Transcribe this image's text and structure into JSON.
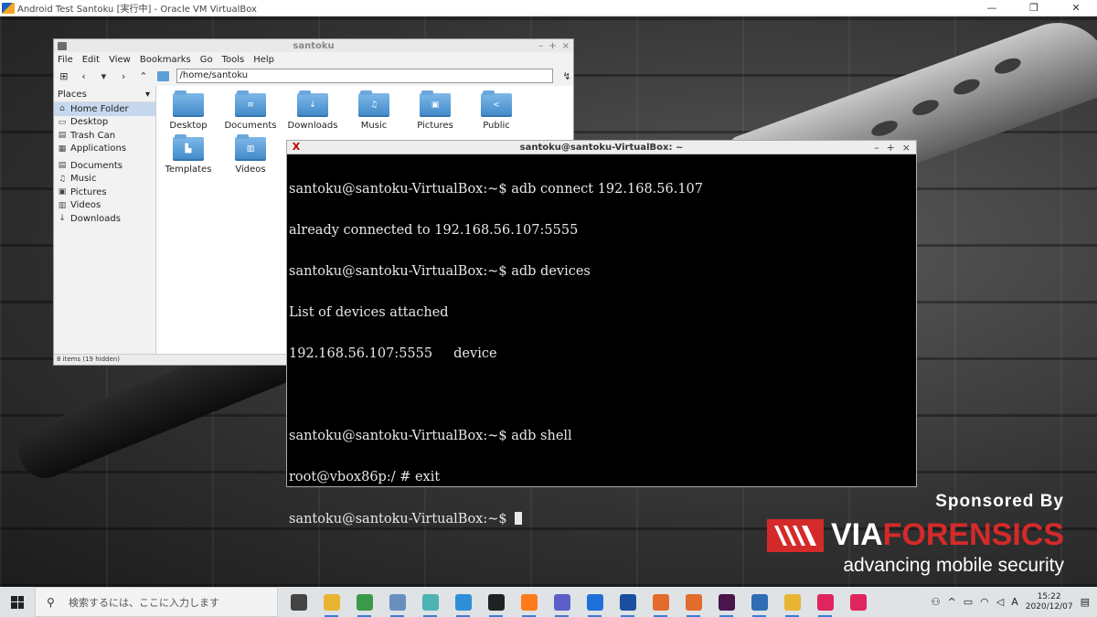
{
  "vbox": {
    "title": "Android Test Santoku [実行中] - Oracle VM VirtualBox",
    "minimize": "—",
    "maximize": "❐",
    "close": "✕"
  },
  "file_manager": {
    "title": "santoku",
    "window_controls": [
      "–",
      "+",
      "×"
    ],
    "menu": [
      "File",
      "Edit",
      "View",
      "Bookmarks",
      "Go",
      "Tools",
      "Help"
    ],
    "path": "/home/santoku",
    "places_header": "Places",
    "places_group1": [
      {
        "label": "Home Folder",
        "icon": "home-icon",
        "active": true
      },
      {
        "label": "Desktop",
        "icon": "desktop-icon",
        "active": false
      },
      {
        "label": "Trash Can",
        "icon": "trash-icon",
        "active": false
      },
      {
        "label": "Applications",
        "icon": "applications-icon",
        "active": false
      }
    ],
    "places_group2": [
      {
        "label": "Documents",
        "icon": "documents-icon"
      },
      {
        "label": "Music",
        "icon": "music-icon"
      },
      {
        "label": "Pictures",
        "icon": "pictures-icon"
      },
      {
        "label": "Videos",
        "icon": "videos-icon"
      },
      {
        "label": "Downloads",
        "icon": "downloads-icon"
      }
    ],
    "folders": [
      {
        "label": "Desktop",
        "glyph": ""
      },
      {
        "label": "Documents",
        "glyph": "≡"
      },
      {
        "label": "Downloads",
        "glyph": "↓"
      },
      {
        "label": "Music",
        "glyph": "♫"
      },
      {
        "label": "Pictures",
        "glyph": "▣"
      },
      {
        "label": "Public",
        "glyph": "<"
      },
      {
        "label": "Templates",
        "glyph": "▙"
      },
      {
        "label": "Videos",
        "glyph": "▥"
      }
    ],
    "status": "8 items (19 hidden)"
  },
  "terminal": {
    "title": "santoku@santoku-VirtualBox: ~",
    "window_controls": [
      "–",
      "+",
      "×"
    ],
    "lines": [
      "santoku@santoku-VirtualBox:~$ adb connect 192.168.56.107",
      "already connected to 192.168.56.107:5555",
      "santoku@santoku-VirtualBox:~$ adb devices",
      "List of devices attached",
      "192.168.56.107:5555     device",
      "",
      "santoku@santoku-VirtualBox:~$ adb shell",
      "root@vbox86p:/ # exit",
      "santoku@santoku-VirtualBox:~$ "
    ]
  },
  "sponsor": {
    "heading": "Sponsored By",
    "brand_white": "VIA",
    "brand_red": "FORENSICS",
    "tagline": "advancing mobile security",
    "brand_color": "#d42a2a"
  },
  "taskbar": {
    "search_placeholder": "検索するには、ここに入力します",
    "apps": [
      {
        "name": "task-view-icon",
        "color": "#444444"
      },
      {
        "name": "file-explorer-icon",
        "color": "#e8b533"
      },
      {
        "name": "chrome-icon",
        "color": "#3b9a4a"
      },
      {
        "name": "app-icon-1",
        "color": "#6a8fbf"
      },
      {
        "name": "app-icon-2",
        "color": "#4db3b3"
      },
      {
        "name": "app-icon-3",
        "color": "#2f8fd6"
      },
      {
        "name": "terminal-icon",
        "color": "#222222"
      },
      {
        "name": "firefox-icon",
        "color": "#ff7a1a"
      },
      {
        "name": "teams-icon",
        "color": "#5b5fc7"
      },
      {
        "name": "app-icon-4",
        "color": "#1e6fd9"
      },
      {
        "name": "app-icon-5",
        "color": "#1a4fa0"
      },
      {
        "name": "app-icon-6",
        "color": "#e36b2c"
      },
      {
        "name": "app-icon-7",
        "color": "#e36b2c"
      },
      {
        "name": "slack-icon",
        "color": "#4a154b"
      },
      {
        "name": "virtualbox-icon",
        "color": "#2f6db5"
      },
      {
        "name": "app-icon-8",
        "color": "#e8b533"
      },
      {
        "name": "app-icon-9",
        "color": "#e0245e"
      },
      {
        "name": "app-icon-10",
        "color": "#e0245e"
      }
    ],
    "tray": {
      "ime": "A",
      "time": "15:22",
      "date": "2020/12/07"
    }
  }
}
